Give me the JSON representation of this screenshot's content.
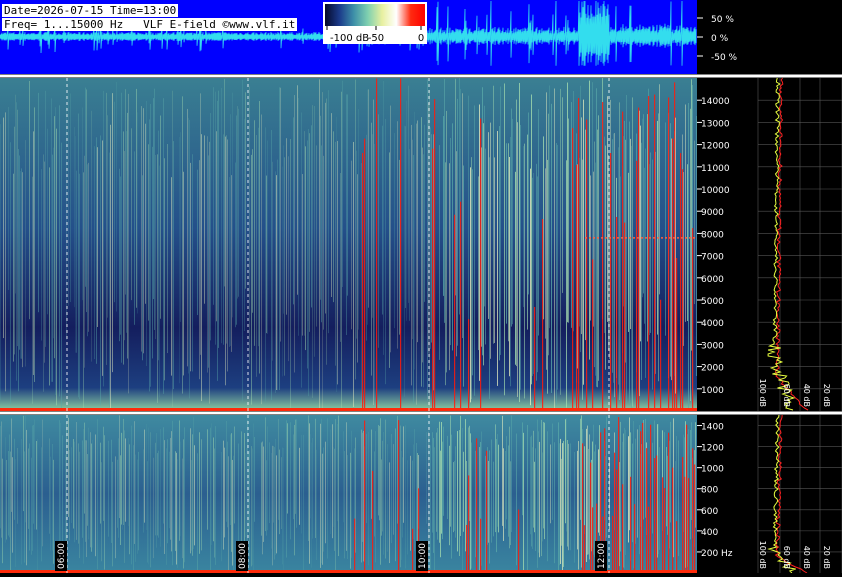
{
  "header": {
    "date_line": "Date=2026-07-15 Time=13:00",
    "freq_line": "Freq= 1...15000 Hz   VLF E-field ©www.vlf.it"
  },
  "colorbar": {
    "labels": [
      "-100 dB",
      "-50",
      "0"
    ],
    "stops": [
      "#050a2a",
      "#1b3a8a",
      "#3d8fa8",
      "#7fd0b0",
      "#e8f0a0",
      "#ffffff",
      "#ff2a10",
      "#ff0000"
    ]
  },
  "chart_data": [
    {
      "type": "line",
      "name": "waveform",
      "y_tick_labels": [
        "50 %",
        "0 %",
        "-50 %"
      ],
      "y_values": [
        50,
        0,
        -50
      ],
      "background": "#0000ff",
      "trace_color": "#33ddee"
    },
    {
      "type": "heatmap",
      "name": "spectrogram-wide",
      "y_range": [
        0,
        15000
      ],
      "y_ticks": [
        1000,
        2000,
        3000,
        4000,
        5000,
        6000,
        7000,
        8000,
        9000,
        10000,
        11000,
        12000,
        13000,
        14000
      ],
      "y_tick_labels": [
        "1000",
        "2000",
        "3000",
        "4000",
        "5000",
        "6000",
        "7000",
        "8000",
        "9000",
        "10000",
        "11000",
        "12000",
        "13000",
        "14000"
      ],
      "spectrum_x_labels": [
        "100 dB",
        "60 dB",
        "40 dB",
        "20 dB"
      ]
    },
    {
      "type": "heatmap",
      "name": "spectrogram-low",
      "y_range": [
        0,
        1500
      ],
      "y_ticks": [
        200,
        400,
        600,
        800,
        1000,
        1200,
        1400
      ],
      "y_tick_labels": [
        "200 Hz",
        "400",
        "600",
        "800",
        "1000",
        "1200",
        "1400"
      ],
      "spectrum_x_labels": [
        "100 dB",
        "60 dB",
        "40 dB",
        "20 dB"
      ],
      "time_labels": [
        "06:00",
        "08:00",
        "10:00",
        "12:00"
      ]
    }
  ]
}
